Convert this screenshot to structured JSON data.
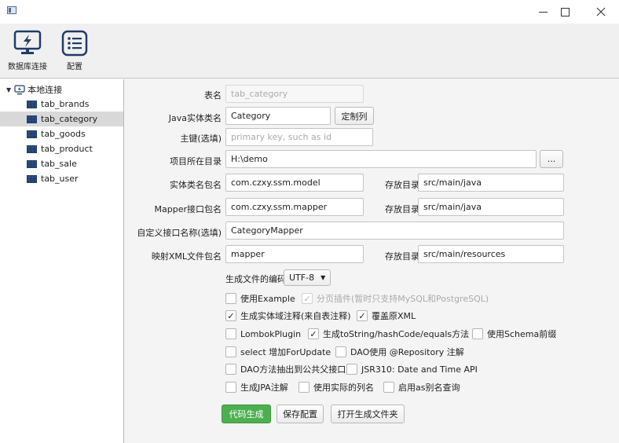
{
  "window": {
    "minimize_glyph": "—",
    "maximize_glyph": "☐",
    "close_glyph": "✕"
  },
  "toolbar": {
    "db_connect_label": "数据库连接",
    "config_label": "配置"
  },
  "tree": {
    "root_label": "本地连接",
    "items": [
      {
        "label": "tab_brands",
        "selected": false
      },
      {
        "label": "tab_category",
        "selected": true
      },
      {
        "label": "tab_goods",
        "selected": false
      },
      {
        "label": "tab_product",
        "selected": false
      },
      {
        "label": "tab_sale",
        "selected": false
      },
      {
        "label": "tab_user",
        "selected": false
      }
    ]
  },
  "form": {
    "table_name": {
      "label": "表名",
      "value": "tab_category"
    },
    "entity_class": {
      "label": "Java实体类名",
      "value": "Category",
      "button": "定制列"
    },
    "primary_key": {
      "label": "主键(选填)",
      "placeholder": "primary key, such as id"
    },
    "project_dir": {
      "label": "项目所在目录",
      "value": "H:\\demo",
      "button": "..."
    },
    "entity_package": {
      "label": "实体类名包名",
      "value": "com.czxy.ssm.model",
      "dir_label": "存放目录",
      "dir_value": "src/main/java"
    },
    "mapper_package": {
      "label": "Mapper接口包名",
      "value": "com.czxy.ssm.mapper",
      "dir_label": "存放目录",
      "dir_value": "src/main/java"
    },
    "custom_interface": {
      "label": "自定义接口名称(选填)",
      "value": "CategoryMapper"
    },
    "xml_package": {
      "label": "映射XML文件包名",
      "value": "mapper",
      "dir_label": "存放目录",
      "dir_value": "src/main/resources"
    },
    "encoding": {
      "label": "生成文件的编码",
      "value": "UTF-8"
    }
  },
  "options": {
    "use_example": {
      "label": "使用Example",
      "checked": false
    },
    "pagination": {
      "label": "分页插件(暂时只支持MySQL和PostgreSQL)",
      "checked": true,
      "disabled": true
    },
    "entity_comment": {
      "label": "生成实体域注释(来自表注释)",
      "checked": true
    },
    "overwrite_xml": {
      "label": "覆盖原XML",
      "checked": true
    },
    "lombok": {
      "label": "LombokPlugin",
      "checked": false
    },
    "tostring": {
      "label": "生成toString/hashCode/equals方法",
      "checked": true
    },
    "schema_prefix": {
      "label": "使用Schema前缀",
      "checked": false
    },
    "for_update": {
      "label": "select 增加ForUpdate",
      "checked": false
    },
    "repository": {
      "label": "DAO使用 @Repository 注解",
      "checked": false
    },
    "dao_parent": {
      "label": "DAO方法抽出到公共父接口",
      "checked": false
    },
    "jsr310": {
      "label": "JSR310: Date and Time API",
      "checked": false
    },
    "jpa": {
      "label": "生成JPA注解",
      "checked": false
    },
    "actual_column": {
      "label": "使用实际的列名",
      "checked": false
    },
    "as_alias": {
      "label": "启用as别名查询",
      "checked": false
    }
  },
  "actions": {
    "generate": "代码生成",
    "save_config": "保存配置",
    "open_folder": "打开生成文件夹"
  },
  "colors": {
    "accent_green": "#4caf50",
    "icon_blue": "#2c4f80"
  }
}
